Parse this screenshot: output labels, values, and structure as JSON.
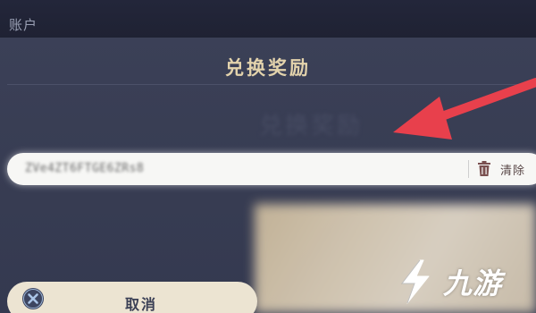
{
  "top": {
    "account_label": "账户"
  },
  "dialog": {
    "title": "兑换奖励",
    "ghost_text": "兑换奖励",
    "code_input": {
      "value": "ZVe4ZT6FTGE6ZRs8"
    },
    "clear_button": {
      "label": "清除",
      "icon": "trash-icon"
    },
    "cancel_button": {
      "label": "取消",
      "icon": "close-circle-icon"
    }
  },
  "watermark": {
    "text": "九游",
    "logo": "jiuyou-logo"
  },
  "colors": {
    "panel": "#3b4057",
    "title": "#e3d3ac",
    "input_bg": "#f7f7f5",
    "cancel_bg": "#ece4d2",
    "arrow": "#e8404c"
  }
}
